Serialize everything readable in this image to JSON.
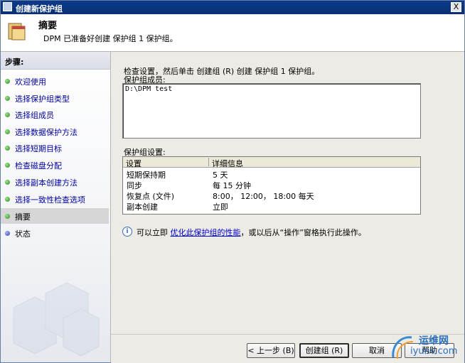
{
  "window": {
    "title": "创建新保护组",
    "close_glyph": "X"
  },
  "header": {
    "title": "摘要",
    "subtitle": "DPM 已准备好创建 保护组 1 保护组。"
  },
  "sidebar": {
    "steps_label": "步骤:",
    "items": [
      {
        "label": "欢迎使用",
        "state": "done"
      },
      {
        "label": "选择保护组类型",
        "state": "done"
      },
      {
        "label": "选择组成员",
        "state": "done"
      },
      {
        "label": "选择数据保护方法",
        "state": "done"
      },
      {
        "label": "选择短期目标",
        "state": "done"
      },
      {
        "label": "检查磁盘分配",
        "state": "done"
      },
      {
        "label": "选择副本创建方法",
        "state": "done"
      },
      {
        "label": "选择一致性检查选项",
        "state": "done"
      },
      {
        "label": "摘要",
        "state": "current"
      },
      {
        "label": "状态",
        "state": "pending"
      }
    ]
  },
  "main": {
    "instruction": "检查设置，然后单击 创建组 (R) 创建 保护组 1 保护组。",
    "members_label": "保护组成员:",
    "members": [
      "D:\\DPM test"
    ],
    "settings_label": "保护组设置:",
    "table": {
      "headers": [
        "设置",
        "详细信息"
      ],
      "rows": [
        [
          "短期保持期",
          "5 天"
        ],
        [
          "同步",
          "每 15 分钟"
        ],
        [
          "恢复点 (文件)",
          "8:00， 12:00， 18:00 每天"
        ],
        [
          "副本创建",
          "立即"
        ]
      ]
    },
    "info": {
      "prefix": "可以立即 ",
      "link": "优化此保护组的性能",
      "suffix": "，或以后从“操作”窗格执行此操作。"
    }
  },
  "buttons": {
    "back": "< 上一步 (B)",
    "create": "创建组 (R)",
    "cancel": "取消",
    "help": "帮助"
  },
  "watermark": {
    "name": "运维网",
    "domain": "iyunv.com"
  },
  "colors": {
    "titlebar": "#0a2f72",
    "link": "#0000cc",
    "step_link": "#0000a0",
    "done_dot": "#2d8a1e",
    "pending_dot": "#2a3fb0"
  }
}
